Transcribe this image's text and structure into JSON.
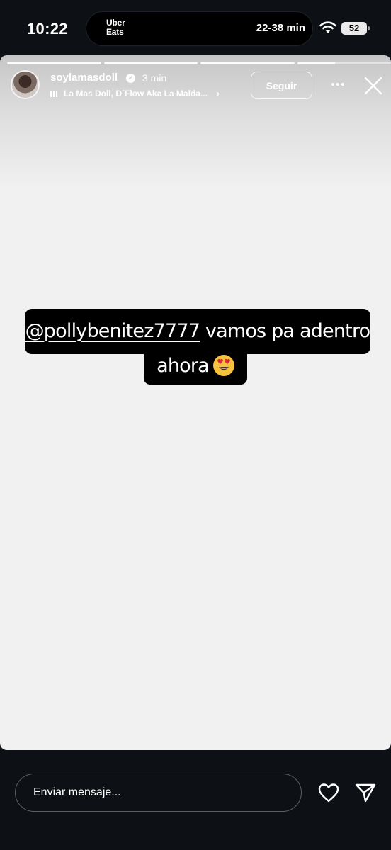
{
  "status_bar": {
    "time": "10:22",
    "activity_brand_line1": "Uber",
    "activity_brand_line2": "Eats",
    "activity_eta": "22-38 min",
    "battery": "52"
  },
  "story": {
    "progress_segments": [
      1,
      1,
      1,
      0.4
    ],
    "username": "soylamasdoll",
    "time_ago": "3 min",
    "music": "La Mas Doll, D´Flow Aka La Malda...",
    "follow_label": "Seguir",
    "caption": {
      "mention": "@pollybenitez7777",
      "line1_rest": " vamos pa adentro",
      "line2": "ahora",
      "emoji": "heart-eyes-emoji"
    },
    "background_color": "#f1f1f1"
  },
  "composer": {
    "placeholder": "Enviar mensaje..."
  },
  "icons": {
    "wifi": "wifi-icon",
    "verified": "verified-badge-icon",
    "music": "music-bars-icon",
    "more": "more-options-icon",
    "close": "close-icon",
    "like": "heart-icon",
    "share": "send-icon"
  }
}
